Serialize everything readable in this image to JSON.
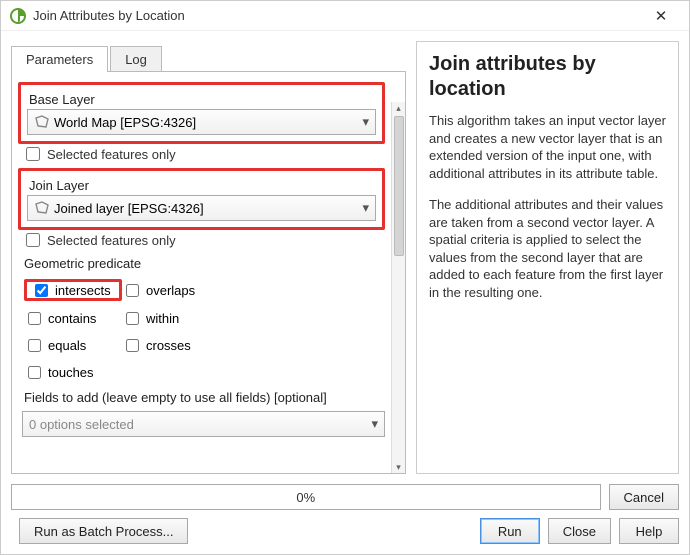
{
  "window": {
    "title": "Join Attributes by Location"
  },
  "tabs": {
    "parameters": "Parameters",
    "log": "Log"
  },
  "params": {
    "baseLayerLabel": "Base Layer",
    "baseLayerValue": "World Map [EPSG:4326]",
    "selectedOnly1": "Selected features only",
    "joinLayerLabel": "Join Layer",
    "joinLayerValue": "Joined layer [EPSG:4326]",
    "selectedOnly2": "Selected features only",
    "geomPredicateLabel": "Geometric predicate",
    "pred": {
      "intersects": "intersects",
      "overlaps": "overlaps",
      "contains": "contains",
      "within": "within",
      "equals": "equals",
      "crosses": "crosses",
      "touches": "touches"
    },
    "fieldsLabel": "Fields to add (leave empty to use all fields) [optional]",
    "fieldsValue": "0 options selected"
  },
  "desc": {
    "title": "Join attributes by location",
    "p1": "This algorithm takes an input vector layer and creates a new vector layer that is an extended version of the input one, with additional attributes in its attribute table.",
    "p2": "The additional attributes and their values are taken from a second vector layer. A spatial criteria is applied to select the values from the second layer that are added to each feature from the first layer in the resulting one."
  },
  "progress": {
    "text": "0%"
  },
  "buttons": {
    "cancel": "Cancel",
    "batch": "Run as Batch Process...",
    "run": "Run",
    "close": "Close",
    "help": "Help"
  }
}
